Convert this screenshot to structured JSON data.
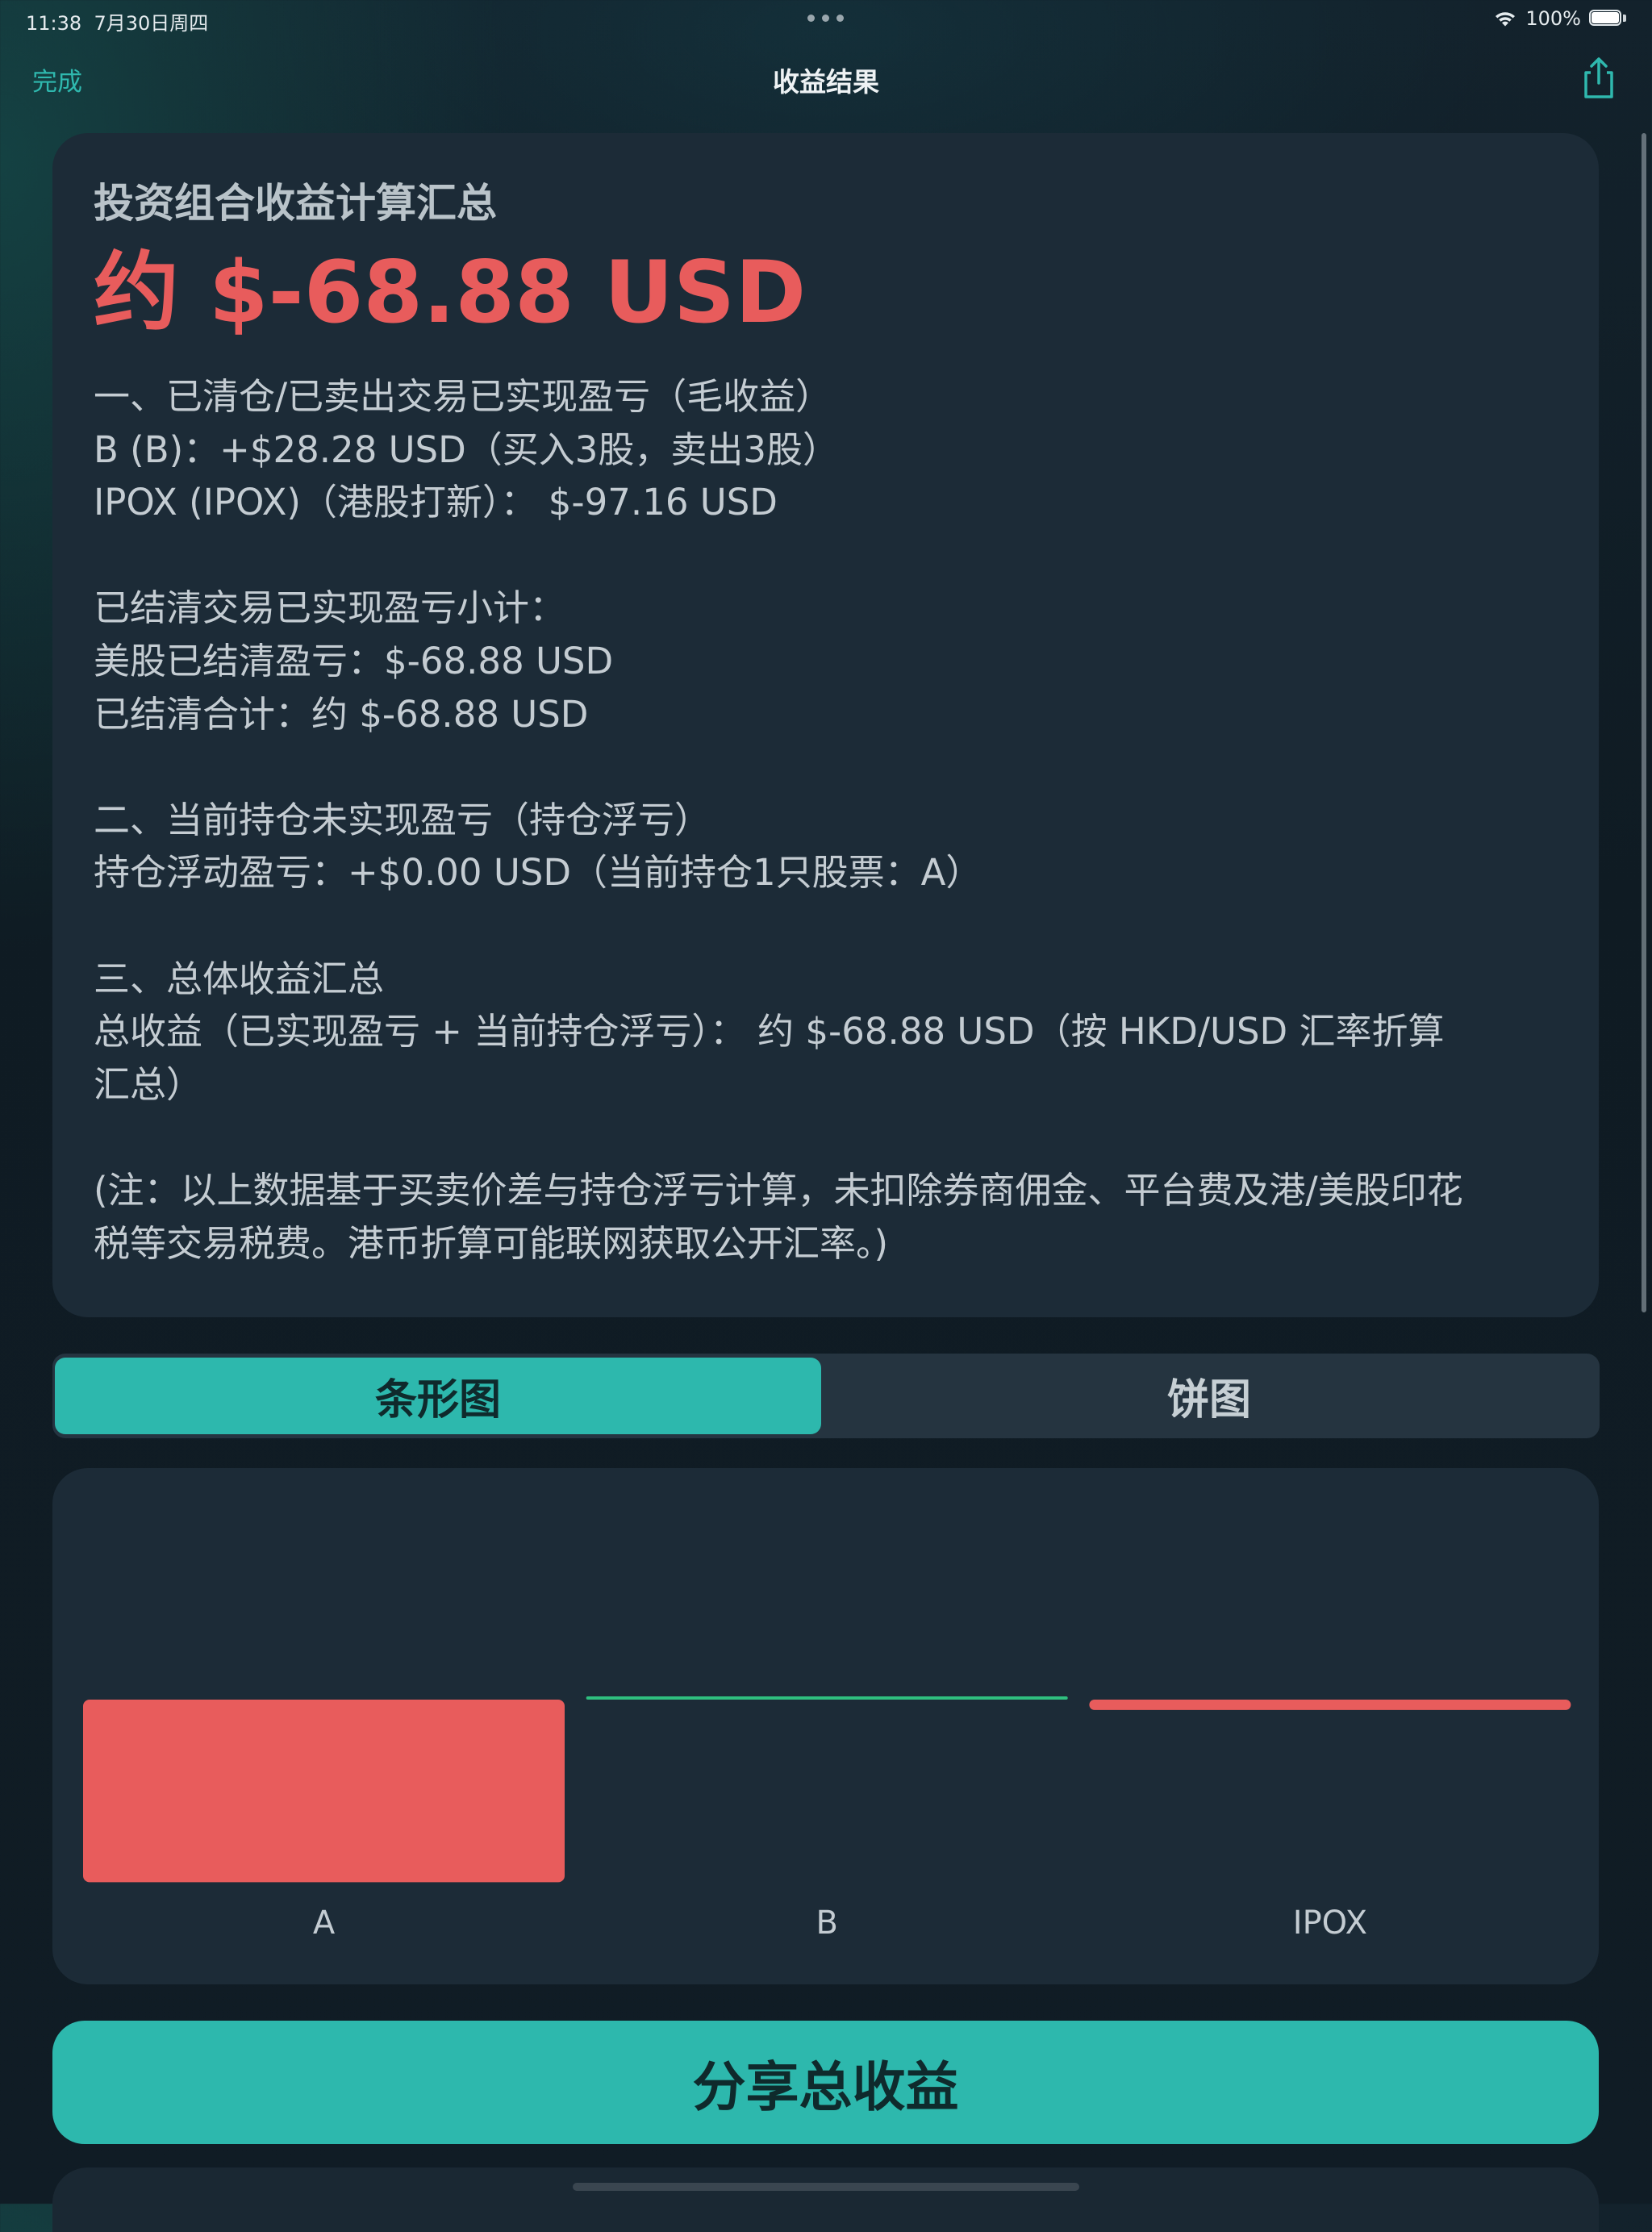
{
  "status_bar": {
    "time": "11:38",
    "date": "7月30日周四",
    "battery_text": "100%",
    "battery_level": 1.0,
    "wifi_icon": "wifi-icon",
    "battery_icon": "battery-icon"
  },
  "nav": {
    "done_label": "完成",
    "title": "收益结果",
    "share_icon": "share-icon"
  },
  "summary": {
    "title": "投资组合收益计算汇总",
    "total": "约 $-68.88 USD",
    "lines": [
      "一、已清仓/已卖出交易已实现盈亏（毛收益）",
      "B (B)：+$28.28 USD（买入3股，卖出3股）",
      "IPOX (IPOX)（港股打新）： $-97.16 USD",
      "",
      "已结清交易已实现盈亏小计：",
      "美股已结清盈亏：$-68.88 USD",
      "已结清合计：约 $-68.88 USD",
      "",
      "二、当前持仓未实现盈亏（持仓浮亏）",
      "持仓浮动盈亏：+$0.00 USD（当前持仓1只股票：A）",
      "",
      "三、总体收益汇总",
      "总收益（已实现盈亏 + 当前持仓浮亏）： 约 $-68.88 USD（按 HKD/USD 汇率折算",
      "汇总）",
      "",
      "(注：以上数据基于买卖价差与持仓浮亏计算，未扣除券商佣金、平台费及港/美股印花",
      "税等交易税费。港币折算可能联网获取公开汇率。)"
    ]
  },
  "tabs": {
    "bar": "条形图",
    "pie": "饼图",
    "selected": "bar"
  },
  "chart_data": {
    "type": "bar",
    "categories": [
      "A",
      "B",
      "IPOX"
    ],
    "values": [
      -97.16,
      0.05,
      -5.5
    ],
    "colors": [
      "#e85c5c",
      "#2fbf7f",
      "#e85c5c"
    ],
    "positive_color": "#2fbf7f",
    "negative_color": "#e85c5c",
    "xlabel": "",
    "ylabel": "",
    "ylim": [
      -100,
      0
    ],
    "grid": false,
    "legend": "none"
  },
  "actions": {
    "share_total_label": "分享总收益"
  }
}
